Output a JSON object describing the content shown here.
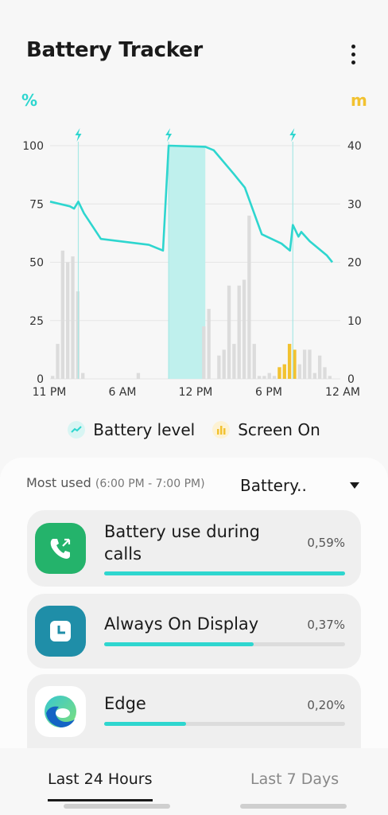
{
  "app": {
    "title": "Battery Tracker"
  },
  "header": {
    "menu_icon": "more-vertical-icon"
  },
  "chart": {
    "left_unit": "%",
    "right_unit": "m",
    "left_ticks": [
      "100",
      "75",
      "50",
      "25",
      "0"
    ],
    "right_ticks": [
      "40",
      "30",
      "20",
      "10",
      "0"
    ],
    "x_ticks": [
      "11 PM",
      "6 AM",
      "12 PM",
      "6 PM",
      "12 AM"
    ],
    "charge_icon": "lightning-icon"
  },
  "chart_data": {
    "type": "line+bar",
    "y_left": {
      "unit": "%",
      "range": [
        0,
        100
      ]
    },
    "y_right": {
      "unit": "m",
      "range": [
        0,
        40
      ]
    },
    "x_ticks": [
      "11 PM",
      "6 AM",
      "12 PM",
      "6 PM",
      "12 AM"
    ],
    "series": [
      {
        "name": "Battery level",
        "type": "line",
        "axis": "left",
        "points": [
          [
            0.0,
            76
          ],
          [
            0.07,
            74
          ],
          [
            0.085,
            73
          ],
          [
            0.1,
            76
          ],
          [
            0.12,
            71
          ],
          [
            0.18,
            60
          ],
          [
            0.35,
            57.5
          ],
          [
            0.4,
            55
          ],
          [
            0.42,
            100
          ],
          [
            0.55,
            99.5
          ],
          [
            0.58,
            98
          ],
          [
            0.65,
            88
          ],
          [
            0.69,
            82
          ],
          [
            0.72,
            72
          ],
          [
            0.75,
            62
          ],
          [
            0.82,
            58
          ],
          [
            0.85,
            55
          ],
          [
            0.86,
            66
          ],
          [
            0.88,
            61
          ],
          [
            0.89,
            63
          ],
          [
            0.92,
            59
          ],
          [
            0.98,
            53
          ],
          [
            1.0,
            50
          ]
        ]
      },
      {
        "name": "Screen On",
        "type": "bar",
        "axis": "right",
        "values": [
          0.5,
          6,
          22,
          20,
          21,
          15,
          1,
          0,
          0,
          0,
          0,
          0,
          0,
          0,
          0,
          0,
          0,
          1,
          0,
          0,
          0,
          0,
          0,
          0,
          0,
          0,
          0,
          0,
          0,
          0,
          9,
          12,
          0,
          4,
          5,
          16,
          6,
          16,
          17,
          28,
          6,
          0.5,
          0.5,
          1,
          0.5,
          2,
          2.5,
          6,
          5,
          2.5,
          5,
          5,
          1,
          4,
          2,
          0.5
        ],
        "highlight_yellow_indices": [
          45,
          46,
          47,
          48
        ]
      }
    ],
    "charge_events": [
      0.1,
      0.42,
      0.86
    ],
    "charging_band": [
      0.42,
      0.55
    ]
  },
  "legend": {
    "battery_label": "Battery level",
    "battery_icon": "battery-level-icon",
    "screen_label": "Screen On",
    "screen_icon": "screen-on-icon",
    "colors": {
      "battery": "#2ed6cf",
      "screen": "#f2c230"
    }
  },
  "most_used": {
    "label": "Most used",
    "range": "(6:00 PM - 7:00 PM)",
    "dropdown_value": "Battery..",
    "dropdown_icon": "caret-down-icon"
  },
  "apps": [
    {
      "name": "Battery use during calls",
      "percent": "0,59%",
      "usage_fraction": 1.0,
      "icon": "phone-call-icon"
    },
    {
      "name": "Always On Display",
      "percent": "0,37%",
      "usage_fraction": 0.62,
      "icon": "clock-icon"
    },
    {
      "name": "Edge",
      "percent": "0,20%",
      "usage_fraction": 0.34,
      "icon": "edge-browser-icon"
    }
  ],
  "tabs": {
    "active": "Last 24 Hours",
    "inactive": "Last 7 Days"
  }
}
